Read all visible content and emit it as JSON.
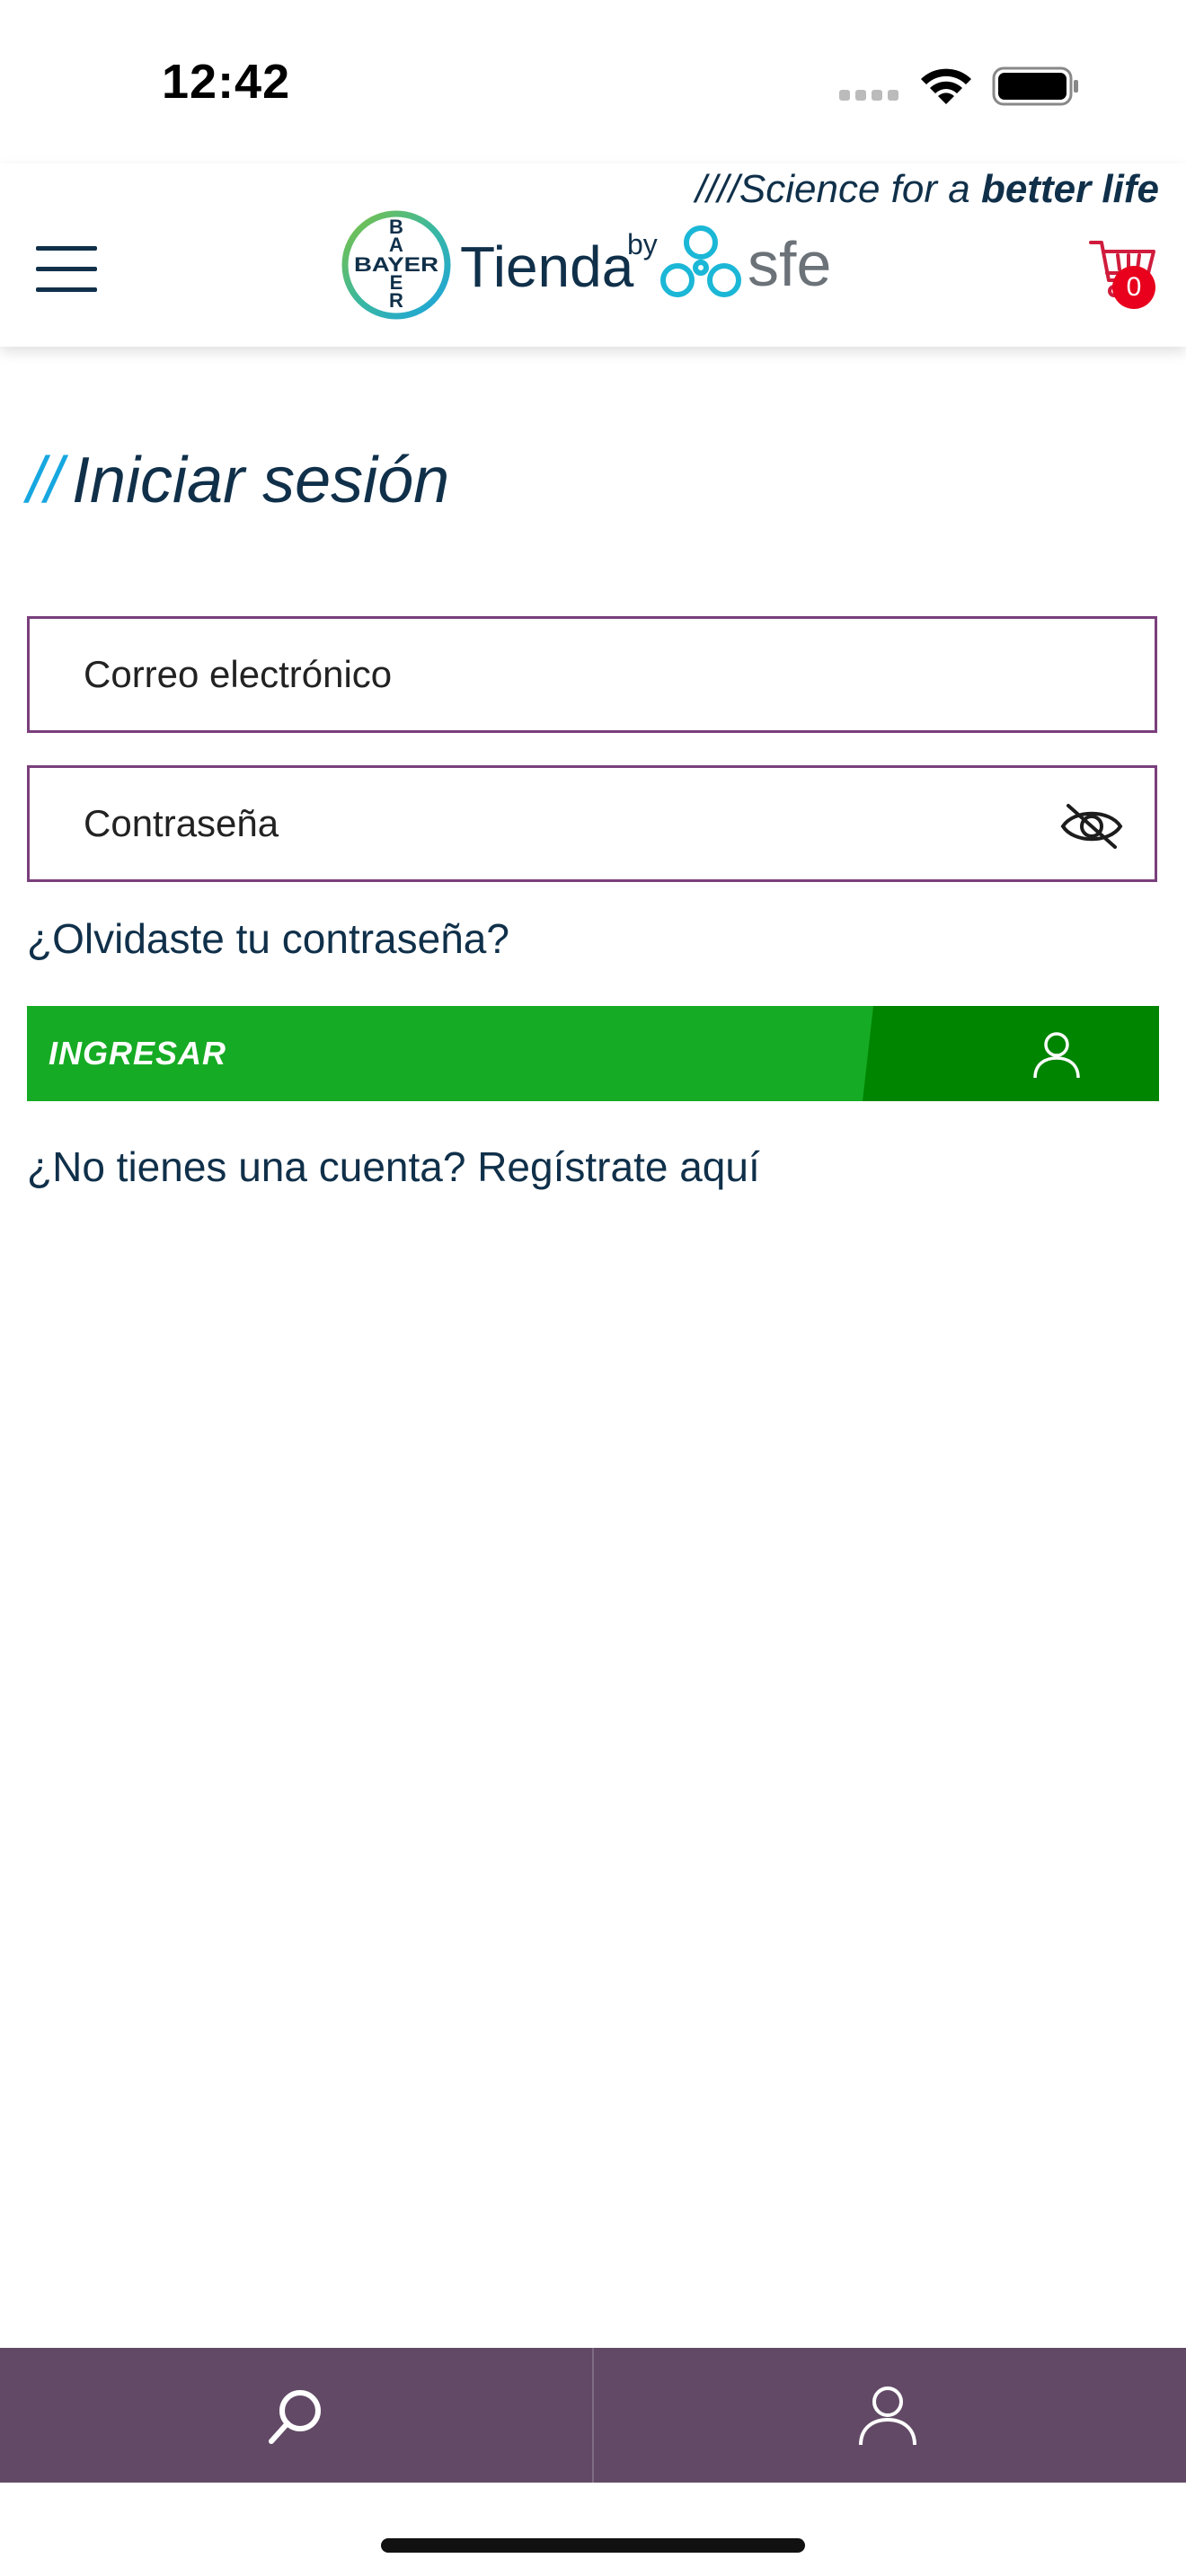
{
  "status_bar": {
    "time": "12:42"
  },
  "header": {
    "tagline_prefix": "////Science for a ",
    "tagline_bold": "better life",
    "logo_brand": "BAYER",
    "logo_text": "Tienda",
    "logo_by": "by",
    "logo_partner": "sfe",
    "cart_count": "0"
  },
  "login": {
    "title_slashes": "//",
    "title": "Iniciar sesión",
    "email_placeholder": "Correo electrónico",
    "password_placeholder": "Contraseña",
    "forgot_password": "¿Olvidaste tu contraseña?",
    "submit_label": "INGRESAR",
    "register_prompt": "¿No tienes una cuenta? Regístrate aquí"
  },
  "bottom_nav": {
    "items": [
      {
        "icon": "search-icon"
      },
      {
        "icon": "user-icon"
      }
    ]
  },
  "colors": {
    "primary_text": "#10304a",
    "accent_blue": "#17a7e0",
    "input_border": "#7a3f7c",
    "button_green": "#16ab24",
    "button_green_dark": "#008500",
    "nav_background": "#624a66",
    "badge_red": "#e8001c"
  }
}
